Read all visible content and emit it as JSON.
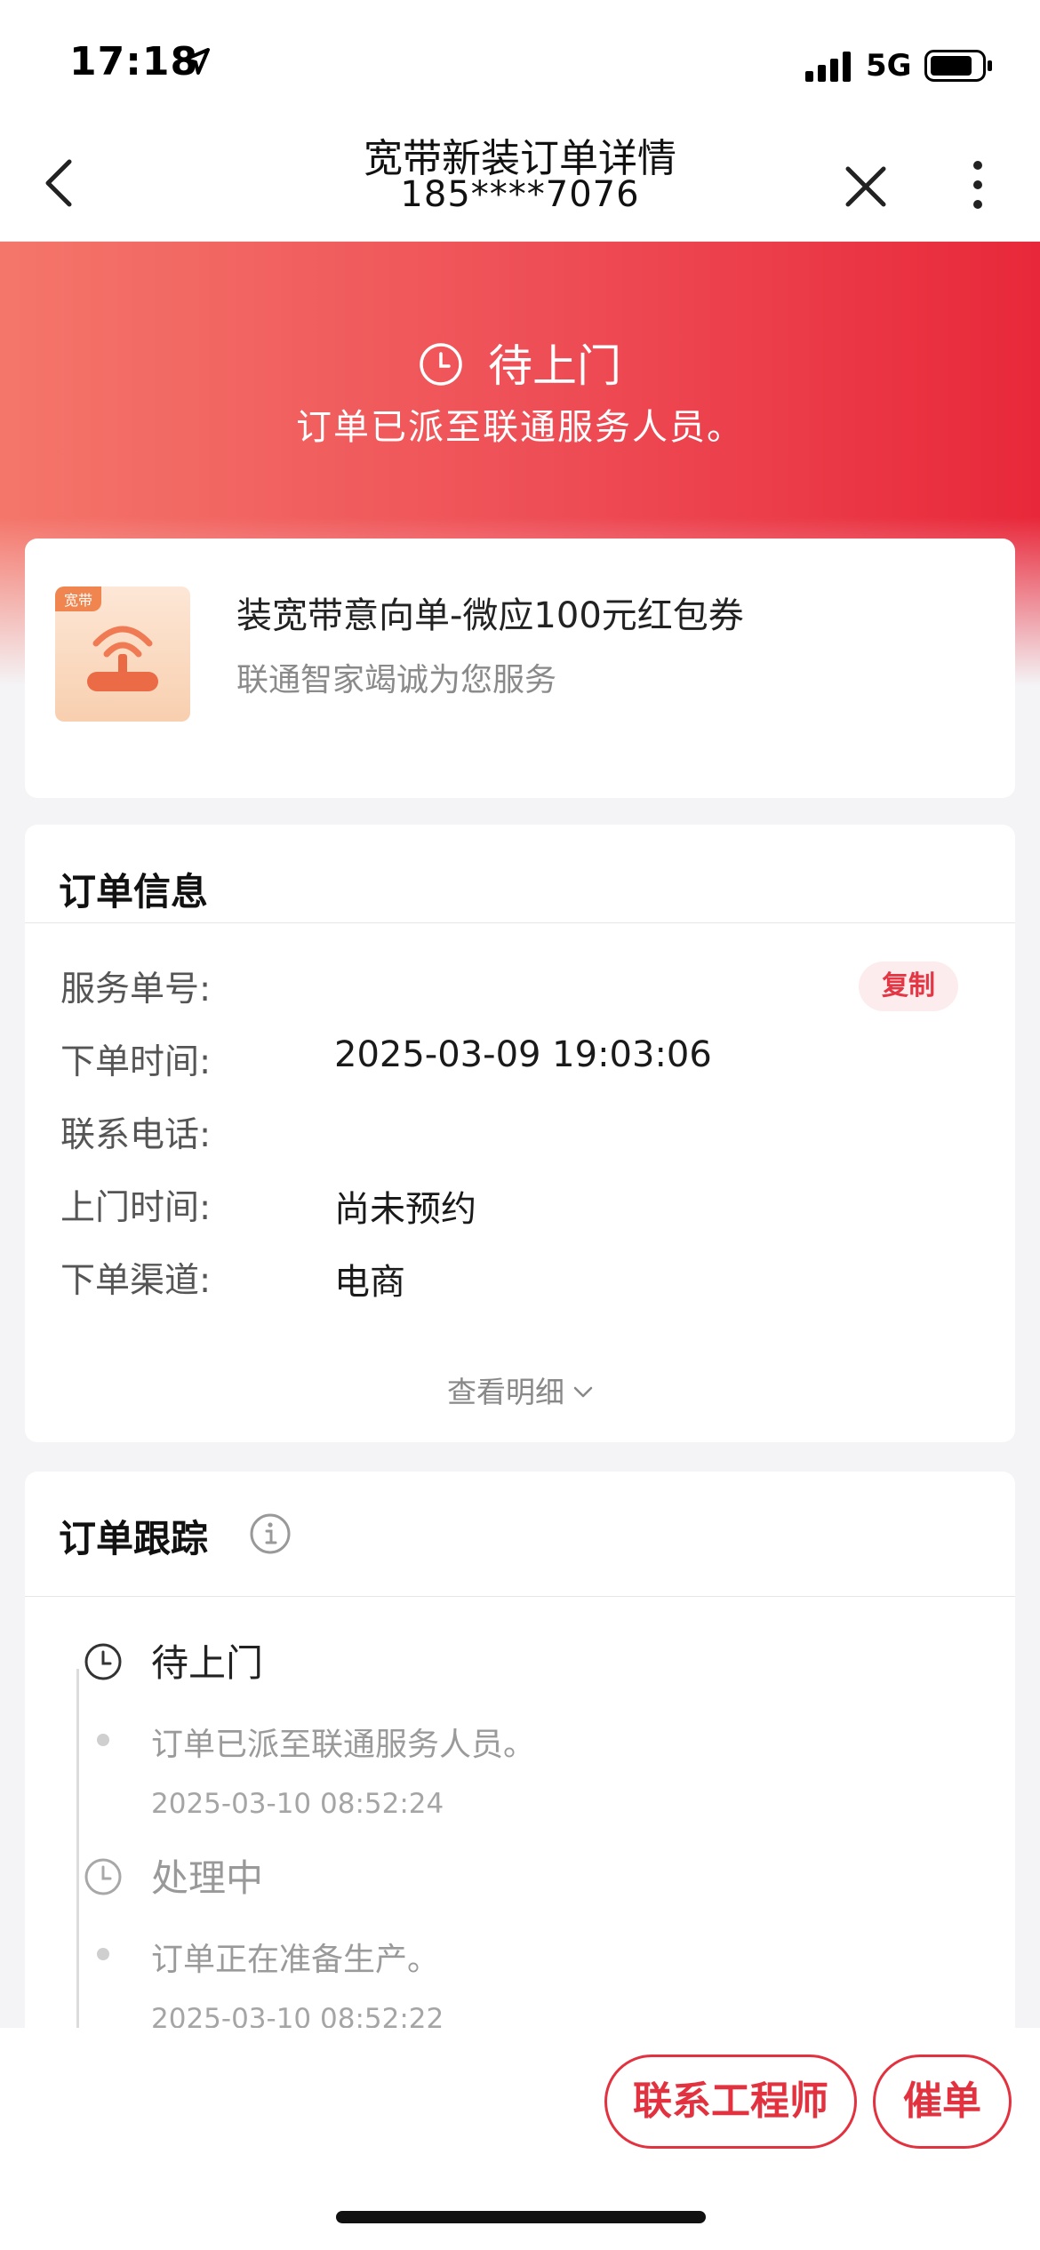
{
  "status_bar": {
    "time": "17:18",
    "network": "5G"
  },
  "nav": {
    "title": "宽带新装订单详情",
    "subtitle": "185****7076"
  },
  "hero": {
    "status": "待上门",
    "description": "订单已派至联通服务人员。"
  },
  "product": {
    "tag": "宽带",
    "title": "装宽带意向单-微应100元红包券",
    "subtitle": "联通智家竭诚为您服务"
  },
  "order_info": {
    "title": "订单信息",
    "copy_label": "复制",
    "rows": [
      {
        "label": "服务单号:",
        "value": ""
      },
      {
        "label": "下单时间:",
        "value": "2025-03-09 19:03:06"
      },
      {
        "label": "联系电话:",
        "value": ""
      },
      {
        "label": "上门时间:",
        "value": "尚未预约"
      },
      {
        "label": "下单渠道:",
        "value": "电商"
      }
    ],
    "view_detail": "查看明细"
  },
  "tracking": {
    "title": "订单跟踪",
    "events": [
      {
        "status": "待上门",
        "description": "订单已派至联通服务人员。",
        "time": "2025-03-10 08:52:24"
      },
      {
        "status": "处理中",
        "description": "订单正在准备生产。",
        "time": "2025-03-10 08:52:22"
      }
    ]
  },
  "actions": {
    "contact_engineer": "联系工程师",
    "urge": "催单"
  },
  "colors": {
    "accent": "#e3323f",
    "hero_start": "#f4766a",
    "hero_end": "#e8283a"
  }
}
